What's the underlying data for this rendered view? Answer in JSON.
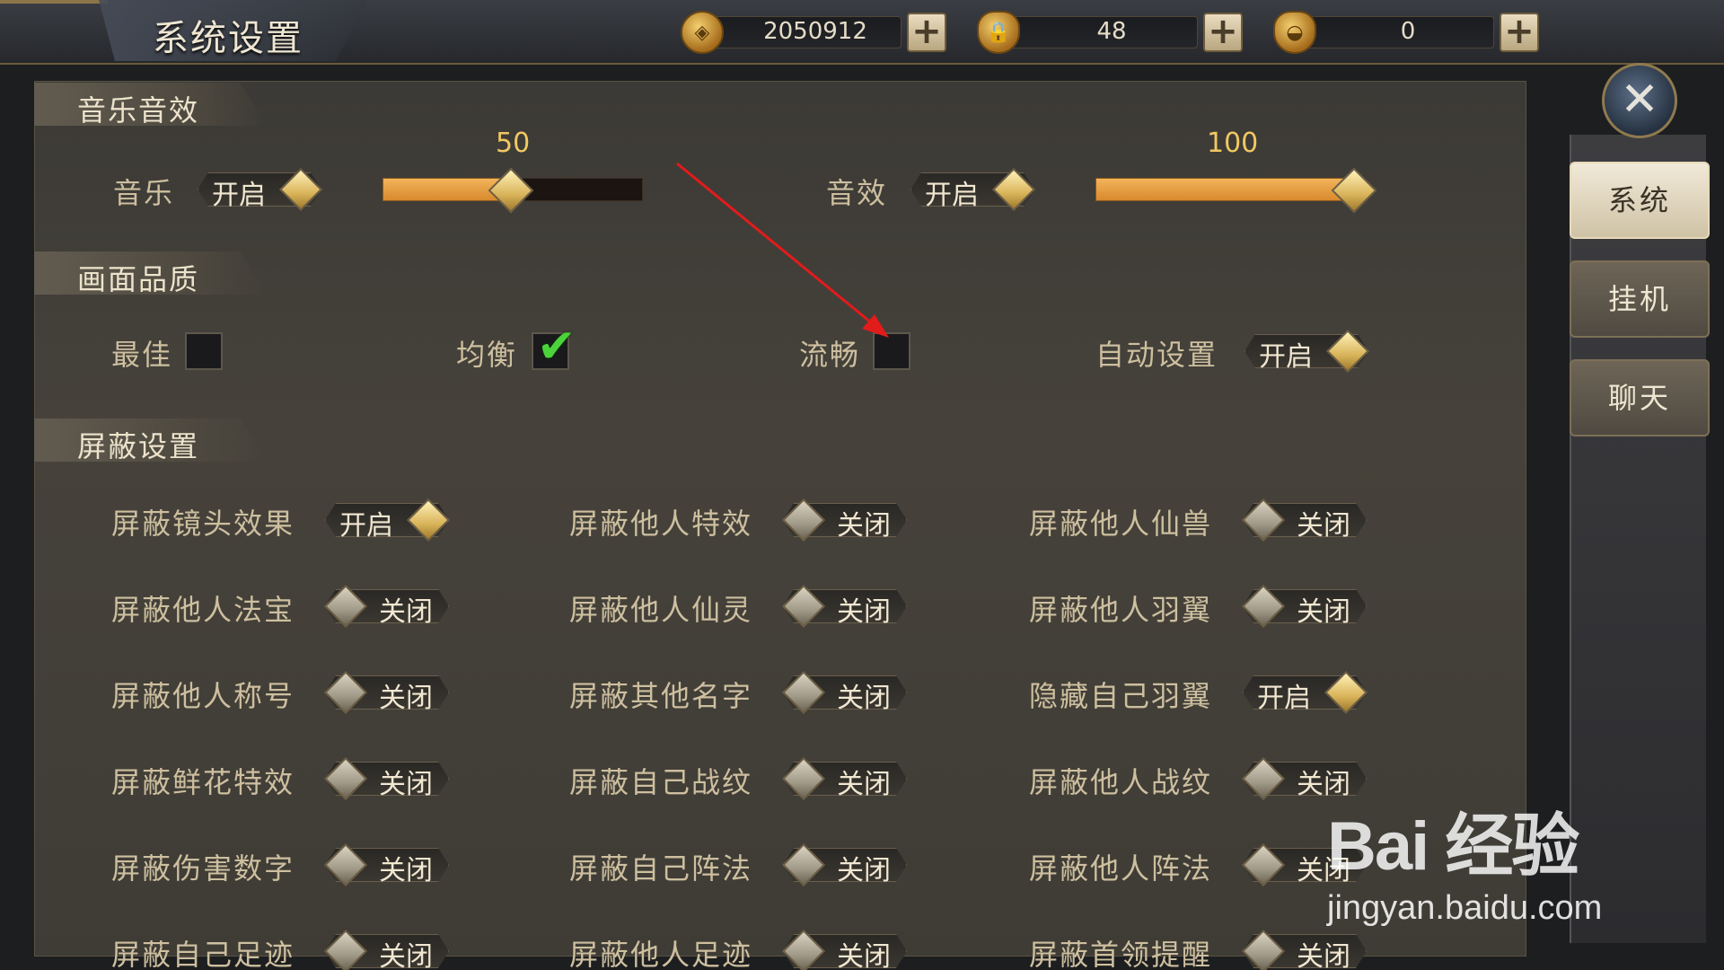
{
  "header": {
    "title": "系统设置",
    "currencies": [
      {
        "icon": "copper-coin-icon",
        "value": "2050912"
      },
      {
        "icon": "locked-gold-ingot-icon",
        "value": "48"
      },
      {
        "icon": "gold-ingot-icon",
        "value": "0"
      }
    ]
  },
  "audio": {
    "section_title": "音乐音效",
    "music": {
      "label": "音乐",
      "toggle": "开启",
      "level": 50,
      "level_text": "50"
    },
    "sfx": {
      "label": "音效",
      "toggle": "开启",
      "level": 100,
      "level_text": "100"
    }
  },
  "quality": {
    "section_title": "画面品质",
    "options": [
      {
        "label": "最佳",
        "checked": false
      },
      {
        "label": "均衡",
        "checked": true
      },
      {
        "label": "流畅",
        "checked": false
      }
    ],
    "auto": {
      "label": "自动设置",
      "toggle": "开启"
    }
  },
  "shield": {
    "section_title": "屏蔽设置",
    "rows": [
      [
        {
          "label": "屏蔽镜头效果",
          "toggle": "开启"
        },
        {
          "label": "屏蔽他人特效",
          "toggle": "关闭"
        },
        {
          "label": "屏蔽他人仙兽",
          "toggle": "关闭"
        }
      ],
      [
        {
          "label": "屏蔽他人法宝",
          "toggle": "关闭"
        },
        {
          "label": "屏蔽他人仙灵",
          "toggle": "关闭"
        },
        {
          "label": "屏蔽他人羽翼",
          "toggle": "关闭"
        }
      ],
      [
        {
          "label": "屏蔽他人称号",
          "toggle": "关闭"
        },
        {
          "label": "屏蔽其他名字",
          "toggle": "关闭"
        },
        {
          "label": "隐藏自己羽翼",
          "toggle": "开启"
        }
      ],
      [
        {
          "label": "屏蔽鲜花特效",
          "toggle": "关闭"
        },
        {
          "label": "屏蔽自己战纹",
          "toggle": "关闭"
        },
        {
          "label": "屏蔽他人战纹",
          "toggle": "关闭"
        }
      ],
      [
        {
          "label": "屏蔽伤害数字",
          "toggle": "关闭"
        },
        {
          "label": "屏蔽自己阵法",
          "toggle": "关闭"
        },
        {
          "label": "屏蔽他人阵法",
          "toggle": "关闭"
        }
      ],
      [
        {
          "label": "屏蔽自己足迹",
          "toggle": "关闭"
        },
        {
          "label": "屏蔽他人足迹",
          "toggle": "关闭"
        },
        {
          "label": "屏蔽首领提醒",
          "toggle": "关闭"
        }
      ]
    ]
  },
  "side_tabs": [
    {
      "label": "系统",
      "active": true
    },
    {
      "label": "挂机",
      "active": false
    },
    {
      "label": "聊天",
      "active": false
    }
  ],
  "close_icon": "close-x-icon",
  "watermark": {
    "main": "Bai 经验",
    "sub": "jingyan.baidu.com"
  },
  "colors": {
    "accent_gold": "#f0c862",
    "slider_fill": "#e39a3c",
    "check_green": "#4bd43a",
    "annotation_arrow": "#e21b1b"
  }
}
